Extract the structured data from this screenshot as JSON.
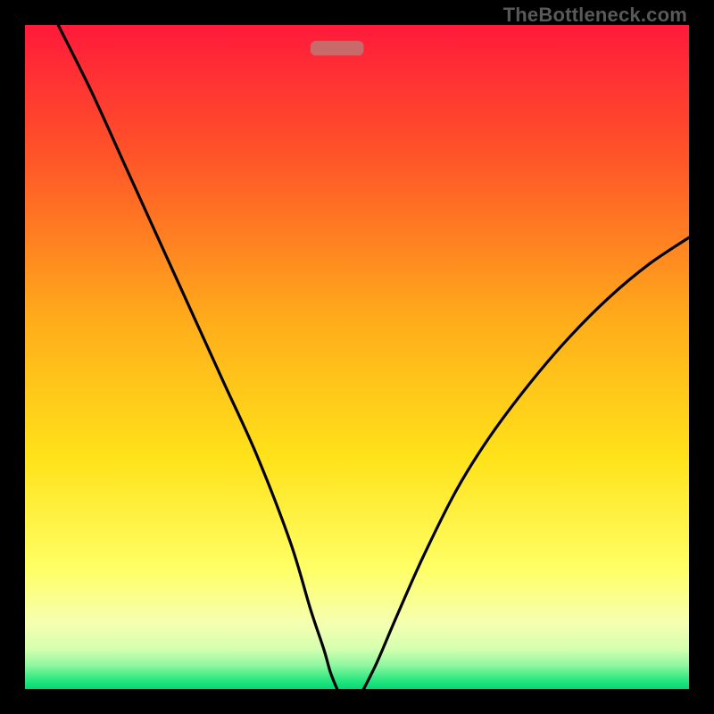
{
  "watermark": "TheBottleneck.com",
  "chart_data": {
    "type": "line",
    "title": "",
    "xlabel": "",
    "ylabel": "",
    "xlim": [
      0,
      100
    ],
    "ylim": [
      0,
      100
    ],
    "grid": false,
    "legend": false,
    "background_gradient_stops": [
      {
        "offset": 0.0,
        "color": "#ff1a3b"
      },
      {
        "offset": 0.2,
        "color": "#ff5528"
      },
      {
        "offset": 0.45,
        "color": "#ffae1a"
      },
      {
        "offset": 0.65,
        "color": "#ffe21a"
      },
      {
        "offset": 0.82,
        "color": "#ffff66"
      },
      {
        "offset": 0.9,
        "color": "#f6ffb0"
      },
      {
        "offset": 0.94,
        "color": "#d4ffb0"
      },
      {
        "offset": 0.965,
        "color": "#8cf7a0"
      },
      {
        "offset": 0.985,
        "color": "#30e880"
      },
      {
        "offset": 1.0,
        "color": "#00d977"
      }
    ],
    "marker": {
      "x_center": 47,
      "y": 96.5,
      "width": 8,
      "height": 2.2,
      "color": "#c96a6a"
    },
    "series": [
      {
        "name": "left-curve",
        "x": [
          5,
          10,
          15,
          20,
          25,
          30,
          35,
          40,
          43,
          45,
          46,
          47
        ],
        "y": [
          100,
          90,
          79,
          68,
          57,
          46,
          35,
          22,
          12,
          6,
          2.5,
          0
        ]
      },
      {
        "name": "right-curve",
        "x": [
          51,
          53,
          56,
          60,
          65,
          70,
          76,
          82,
          88,
          94,
          100
        ],
        "y": [
          0,
          4,
          11,
          20,
          30,
          38,
          46,
          53,
          59,
          64,
          68
        ]
      }
    ]
  }
}
